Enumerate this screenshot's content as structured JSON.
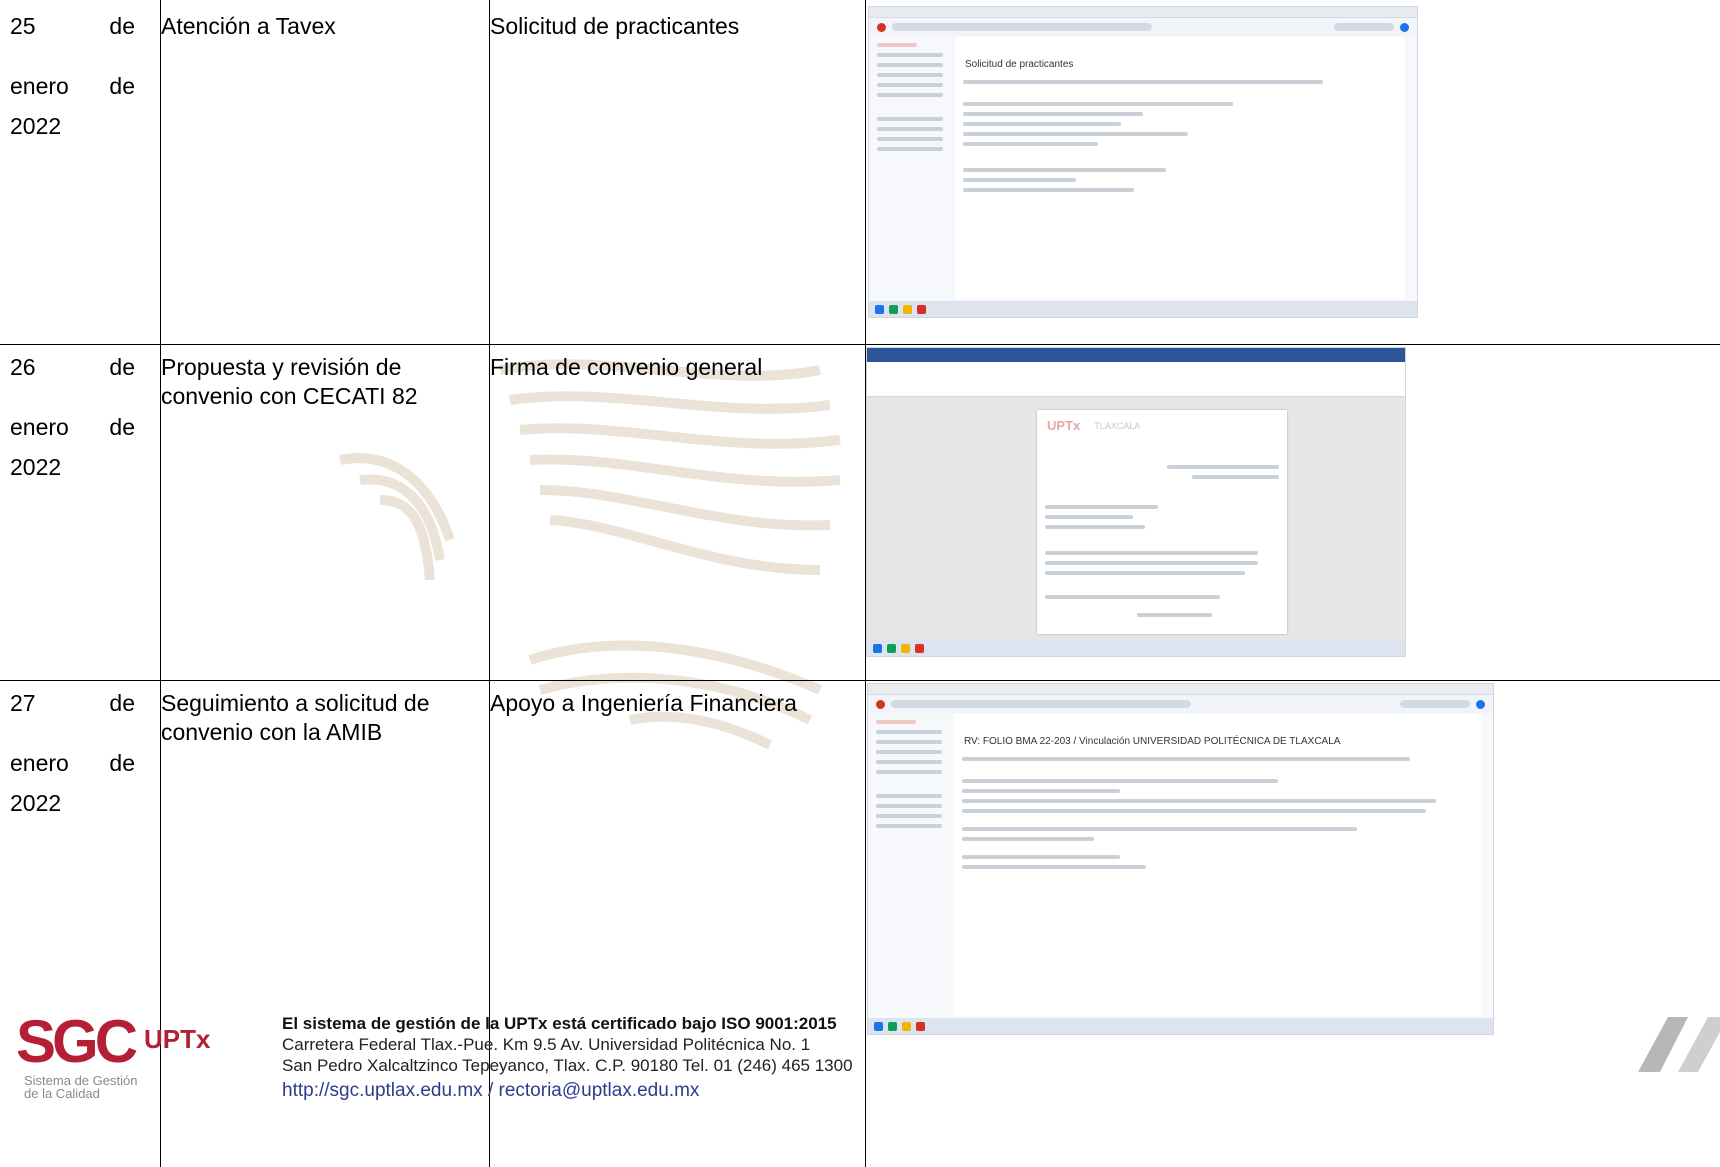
{
  "rows": [
    {
      "date_line1": [
        "25",
        "de"
      ],
      "date_line2": [
        "enero",
        "de"
      ],
      "date_line3": "2022",
      "activity": "Atención a Tavex",
      "result": "Solicitud de practicantes",
      "screenshot": {
        "app": "Gmail",
        "subject": "Solicitud de practicantes"
      }
    },
    {
      "date_line1": [
        "26",
        "de"
      ],
      "date_line2": [
        "enero",
        "de"
      ],
      "date_line3": "2022",
      "activity": "Propuesta y revisión de convenio con CECATI 82",
      "result": "Firma de convenio general",
      "screenshot": {
        "app": "Word",
        "letterhead": "UPTx",
        "letterhead_right": "TLAXCALA"
      }
    },
    {
      "date_line1": [
        "27",
        "de"
      ],
      "date_line2": [
        "enero",
        "de"
      ],
      "date_line3": "2022",
      "activity": "Seguimiento a solicitud de convenio con la AMIB",
      "result": "Apoyo a Ingeniería Financiera",
      "screenshot": {
        "app": "Gmail",
        "subject": "RV: FOLIO BMA 22-203 / Vinculación UNIVERSIDAD POLITÉCNICA DE TLAXCALA"
      }
    }
  ],
  "footer": {
    "logo_text": "SGC",
    "logo_suffix": "UPTx",
    "logo_caption_1": "Sistema de Gestión",
    "logo_caption_2": "de la Calidad",
    "line1": "El sistema de gestión de la UPTx está certificado bajo ISO 9001:2015",
    "line2": "Carretera Federal Tlax.-Pue. Km 9.5 Av. Universidad Politécnica No. 1",
    "line3": "San Pedro Xalcaltzinco Tepeyanco, Tlax. C.P. 90180 Tel. 01 (246) 465 1300",
    "links": "http://sgc.uptlax.edu.mx / rectoria@uptlax.edu.mx"
  },
  "colors": {
    "brand": "#b51f35",
    "gmail_red": "#d93025",
    "word_blue": "#2b579a"
  }
}
